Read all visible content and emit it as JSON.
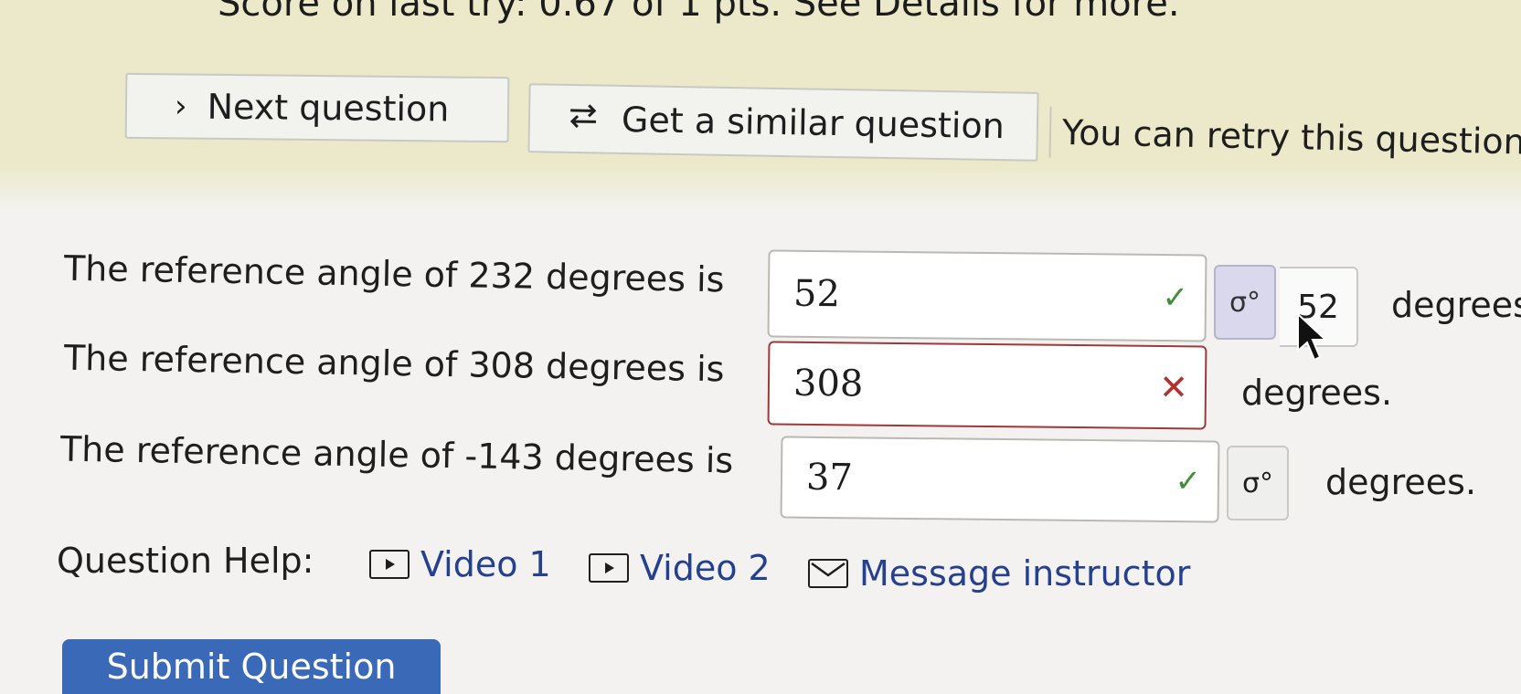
{
  "score": {
    "text": "Score on last try: 0.67 of 1 pts. See Details for more."
  },
  "actions": {
    "next_label": "Next question",
    "similar_label": "Get a similar question",
    "retry_text": "You can retry this question"
  },
  "questions": [
    {
      "prompt": "The reference angle of 232 degrees is",
      "answer": "52",
      "status": "correct",
      "preview_value": "52",
      "unit": "degrees"
    },
    {
      "prompt": "The reference angle of 308 degrees is",
      "answer": "308",
      "status": "incorrect",
      "unit": "degrees."
    },
    {
      "prompt": "The reference angle of -143 degrees is",
      "answer": "37",
      "status": "correct",
      "unit": "degrees."
    }
  ],
  "help": {
    "label": "Question Help:",
    "video1": "Video 1",
    "video2": "Video 2",
    "message": "Message instructor"
  },
  "submit": {
    "label": "Submit Question"
  },
  "marks": {
    "correct": "✓",
    "incorrect": "✕",
    "preview": "σ°"
  }
}
